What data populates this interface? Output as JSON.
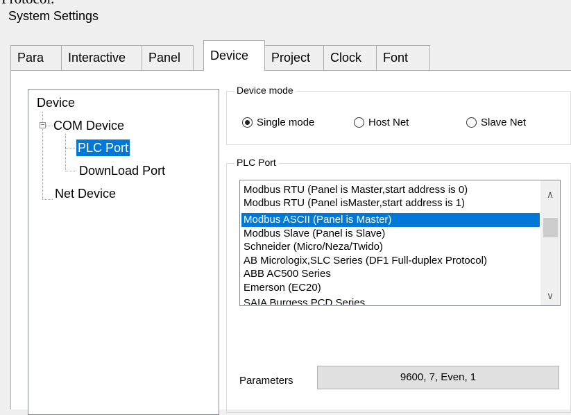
{
  "cropped_text": "Protocol.",
  "window": {
    "title": "System Settings"
  },
  "tabs": [
    {
      "label": "Para"
    },
    {
      "label": "Interactive"
    },
    {
      "label": "Panel"
    },
    {
      "label": "Device",
      "active": true
    },
    {
      "label": "Project"
    },
    {
      "label": "Clock"
    },
    {
      "label": "Font"
    }
  ],
  "tree": {
    "root": "Device",
    "com_device": "COM Device",
    "com_expander": "−",
    "plc_port": "PLC Port",
    "download_port": "DownLoad Port",
    "net_device": "Net Device",
    "selected": "PLC Port"
  },
  "device_mode": {
    "label": "Device mode",
    "options": [
      "Single mode",
      "Host Net",
      "Slave Net"
    ],
    "selected": "Single mode"
  },
  "plc_port": {
    "label": "PLC Port",
    "items": [
      "Modbus RTU (Panel is Master,start address is 0)",
      "Modbus RTU (Panel isMaster,start address is 1)",
      "Modbus ASCII (Panel is Master)",
      "Modbus Slave (Panel is Slave)",
      "Schneider (Micro/Neza/Twido)",
      "AB Micrologix,SLC Series (DF1 Full-duplex Protocol)",
      "ABB AC500 Series",
      "Emerson (EC20)",
      "SAIA Burgess PCD Series"
    ],
    "selected_index": 2,
    "scroll_up": "∧",
    "scroll_down": "∨"
  },
  "parameters": {
    "label": "Parameters",
    "value": "9600, 7, Even, 1"
  },
  "colors": {
    "selection": "#0078d7",
    "window_bg": "#f0f0f0",
    "panel_bg": "#ffffff"
  }
}
